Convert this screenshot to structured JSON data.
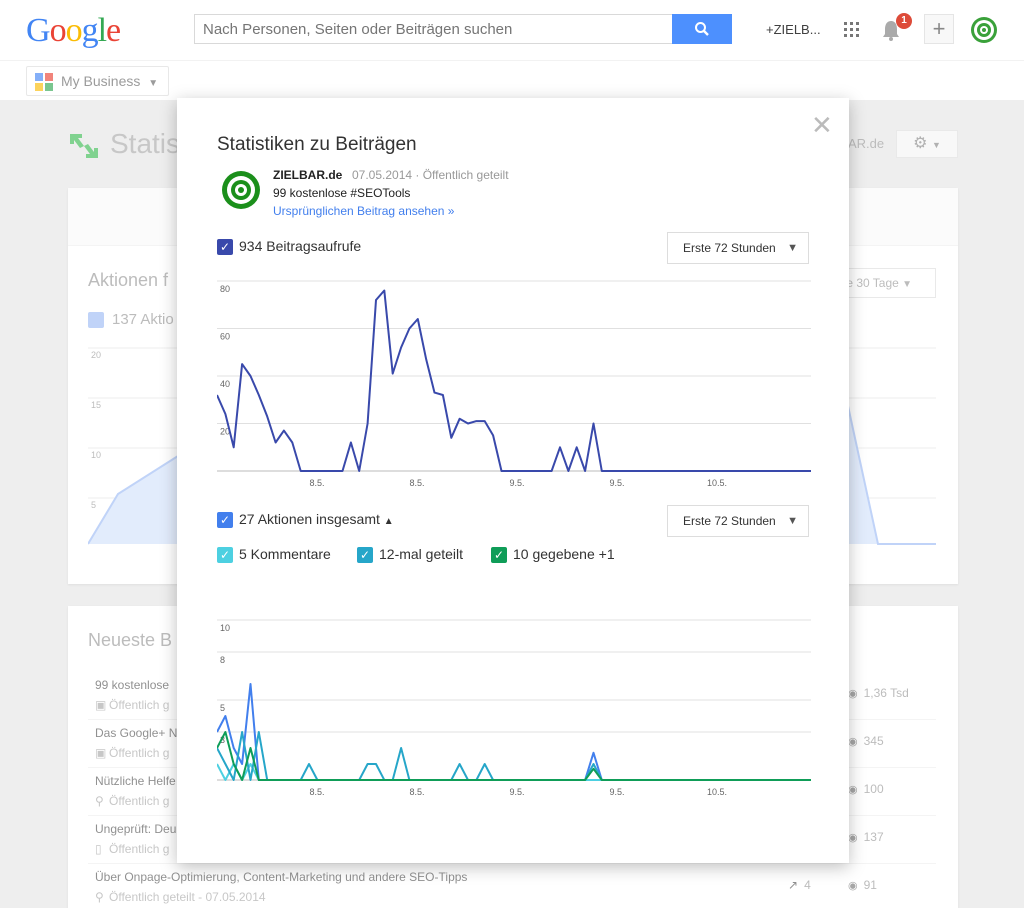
{
  "topbar": {
    "logo": "Google",
    "search_placeholder": "Nach Personen, Seiten oder Beiträgen suchen",
    "plus_name": "+ZIELB...",
    "notification_count": "1",
    "colors": {
      "search_button": "#4d90fe",
      "badge": "#dd4b39"
    }
  },
  "subbar": {
    "product": "My Business"
  },
  "background": {
    "page_title": "Statis",
    "account_suffix": "AR.de",
    "actions_title": "Aktionen f",
    "actions_check": "137 Aktio",
    "actions_range": "te 30 Tage",
    "actions_chart_ticks": [
      "20",
      "15",
      "10",
      "5"
    ],
    "recent_title": "Neueste B",
    "rows": [
      {
        "title": "99 kostenlose",
        "sub": "Öffentlich g",
        "icon": "camera-icon",
        "views": "1,36 Tsd",
        "shares": ""
      },
      {
        "title": "Das Google+ N",
        "sub": "Öffentlich g",
        "icon": "camera-icon",
        "views": "345",
        "shares": ""
      },
      {
        "title": "Nützliche Helfe",
        "sub": "Öffentlich g",
        "icon": "link-icon",
        "views": "100",
        "shares": ""
      },
      {
        "title": "Ungeprüft: Deu",
        "sub": "Öffentlich g",
        "icon": "doc-icon",
        "views": "137",
        "shares": ""
      },
      {
        "title": "Über Onpage-Optimierung, Content-Marketing und andere SEO-Tipps",
        "sub": "Öffentlich geteilt  - 07.05.2014",
        "icon": "link-icon",
        "views": "91",
        "shares": "4"
      }
    ]
  },
  "modal": {
    "title": "Statistiken zu Beiträgen",
    "author": "ZIELBAR.de",
    "date_visibility": "07.05.2014  ·  Öffentlich geteilt",
    "post_text": "99 kostenlose #SEOTools",
    "original_link": "Ursprünglichen Beitrag ansehen »",
    "views_label": "934 Beitragsaufrufe",
    "actions_label": "27 Aktionen insgesamt",
    "range_label": "Erste 72 Stunden",
    "comments_label": "5 Kommentare",
    "shares_label": "12-mal geteilt",
    "plusones_label": "10 gegebene +1",
    "colors": {
      "views": "#3949ab",
      "actions": "#427fed",
      "comments": "#4dd0e1",
      "shares": "#26a6c9",
      "plusones": "#0f9d58"
    }
  },
  "chart_data": [
    {
      "type": "line",
      "y_ticks": [
        "80",
        "60",
        "40",
        "20"
      ],
      "x_ticks": [
        "8.5.",
        "8.5.",
        "9.5.",
        "9.5.",
        "10.5."
      ],
      "ylim": [
        0,
        80
      ],
      "series": [
        {
          "values": [
            32,
            24,
            10,
            45,
            40,
            32,
            23,
            12,
            17,
            12,
            0,
            0,
            0,
            0,
            0,
            0,
            12,
            0,
            20,
            72,
            76,
            41,
            52,
            60,
            64,
            47,
            33,
            32,
            14,
            22,
            20,
            21,
            21,
            15,
            0,
            0,
            0,
            0,
            0,
            0,
            0,
            10,
            0,
            10,
            0,
            20,
            0,
            0,
            0,
            0,
            0,
            0,
            0,
            0,
            0,
            0,
            0,
            0,
            0,
            0,
            0,
            0,
            0,
            0,
            0,
            0,
            0,
            0,
            0,
            0,
            0,
            0
          ]
        }
      ]
    },
    {
      "type": "line",
      "y_ticks": [
        "10",
        "8",
        "5",
        "3"
      ],
      "x_ticks": [
        "8.5.",
        "8.5.",
        "9.5.",
        "9.5.",
        "10.5."
      ],
      "ylim": [
        0,
        10
      ],
      "series": [
        {
          "name": "27 Aktionen insgesamt",
          "values": [
            3,
            4,
            2,
            1,
            6,
            0,
            0,
            0,
            0,
            0,
            0,
            0,
            0,
            0,
            0,
            0,
            0,
            0,
            0,
            0,
            0,
            0,
            0,
            0,
            0,
            0,
            0,
            0,
            0,
            0,
            0,
            0,
            0,
            0,
            0,
            0,
            0,
            0,
            0,
            0,
            0,
            0,
            0,
            0,
            0,
            1.7,
            0,
            0,
            0,
            0,
            0,
            0,
            0,
            0,
            0,
            0,
            0,
            0,
            0,
            0,
            0,
            0,
            0,
            0,
            0,
            0,
            0,
            0,
            0,
            0,
            0,
            0
          ]
        },
        {
          "name": "5 Kommentare",
          "values": [
            1,
            0,
            1,
            0,
            1,
            0,
            0,
            0,
            0,
            0,
            0,
            0,
            0,
            0,
            0,
            0,
            0,
            0,
            0,
            0,
            0,
            0,
            0,
            0,
            0,
            0,
            0,
            0,
            0,
            0,
            0,
            0,
            0,
            0,
            0,
            0,
            0,
            0,
            0,
            0,
            0,
            0,
            0,
            0,
            0,
            0,
            0,
            0,
            0,
            0,
            0,
            0,
            0,
            0,
            0,
            0,
            0,
            0,
            0,
            0,
            0,
            0,
            0,
            0,
            0,
            0,
            0,
            0,
            0,
            0,
            0,
            0
          ]
        },
        {
          "name": "12-mal geteilt",
          "values": [
            2,
            1,
            0,
            3,
            0,
            3,
            0,
            0,
            0,
            0,
            0,
            1,
            0,
            0,
            0,
            0,
            0,
            0,
            1,
            1,
            0,
            0,
            2,
            0,
            0,
            0,
            0,
            0,
            0,
            1,
            0,
            0,
            1,
            0,
            0,
            0,
            0,
            0,
            0,
            0,
            0,
            0,
            0,
            0,
            0,
            1,
            0,
            0,
            0,
            0,
            0,
            0,
            0,
            0,
            0,
            0,
            0,
            0,
            0,
            0,
            0,
            0,
            0,
            0,
            0,
            0,
            0,
            0,
            0,
            0,
            0,
            0
          ]
        },
        {
          "name": "10 gegebene +1",
          "values": [
            2,
            3,
            1,
            0,
            2,
            0,
            0,
            0,
            0,
            0,
            0,
            0,
            0,
            0,
            0,
            0,
            0,
            0,
            0,
            0,
            0,
            0,
            0,
            0,
            0,
            0,
            0,
            0,
            0,
            0,
            0,
            0,
            0,
            0,
            0,
            0,
            0,
            0,
            0,
            0,
            0,
            0,
            0,
            0,
            0,
            0.7,
            0,
            0,
            0,
            0,
            0,
            0,
            0,
            0,
            0,
            0,
            0,
            0,
            0,
            0,
            0,
            0,
            0,
            0,
            0,
            0,
            0,
            0,
            0,
            0,
            0,
            0
          ]
        }
      ]
    }
  ]
}
